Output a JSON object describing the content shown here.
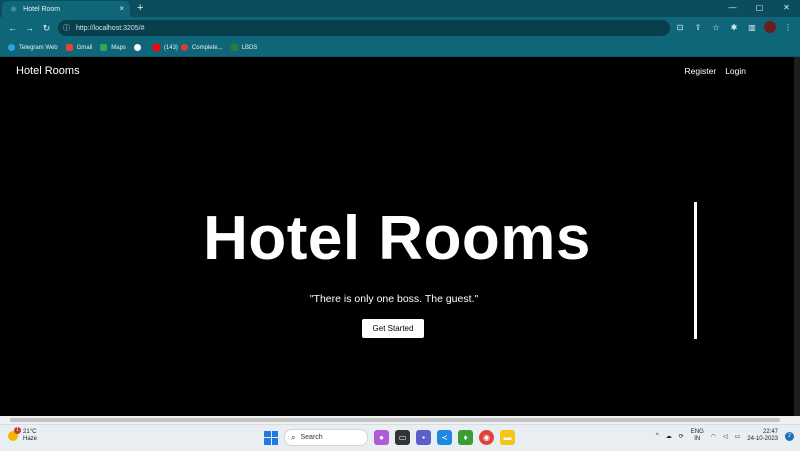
{
  "browser": {
    "tab_title": "Hotel Room",
    "tab_close": "×",
    "new_tab": "+",
    "url": "http://localhost:3205/#",
    "window_controls": {
      "minimize": "—",
      "maximize": "▢",
      "close": "✕"
    }
  },
  "bookmarks": [
    {
      "label": "Telegram Web",
      "color": "#2aa3e0"
    },
    {
      "label": "Gmail",
      "color": "#ea4335"
    },
    {
      "label": "Maps",
      "color": "#34a853"
    },
    {
      "label": "",
      "color": "#ffffff"
    },
    {
      "label": "(143)",
      "color": "#ff0000"
    },
    {
      "label": "Complete...",
      "color": "#e53935"
    },
    {
      "label": "LBDS",
      "color": "#2e7d32"
    }
  ],
  "page": {
    "brand": "Hotel Rooms",
    "nav": {
      "register": "Register",
      "login": "Login"
    },
    "hero_title": "Hotel Rooms",
    "hero_quote": "\"There is only one boss. The guest.\"",
    "cta_label": "Get Started"
  },
  "taskbar": {
    "weather_badge": "1",
    "temperature": "21°C",
    "condition": "Haze",
    "search_label": "Search",
    "lang_top": "ENG",
    "lang_bottom": "IN",
    "time": "22:47",
    "date": "24-10-2023",
    "notification_count": "2"
  },
  "colors": {
    "chrome_frame": "#0b4d5c",
    "chrome_toolbar": "#0e6678",
    "page_bg": "#000000",
    "accent_white": "#ffffff"
  }
}
